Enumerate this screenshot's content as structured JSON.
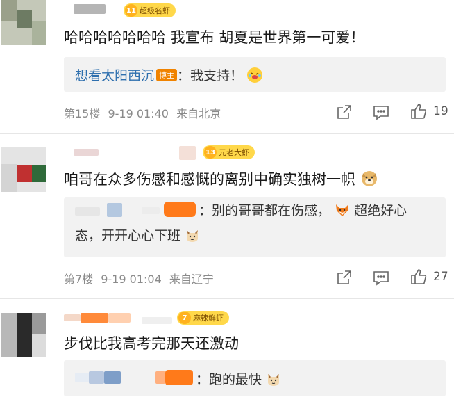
{
  "comments": [
    {
      "badge_level": "11",
      "badge_text": "超级名虾",
      "text": "哈哈哈哈哈哈哈 我宣布 胡夏是世界第一可爱！",
      "reply": {
        "author": "想看太阳西沉",
        "tag": "博主",
        "content": "：我支持！",
        "emoji": "laughing-crying-emoji"
      },
      "floor": "第15楼",
      "time": "9-19 01:40",
      "location": "来自北京",
      "likes": "19"
    },
    {
      "badge_level": "13",
      "badge_text": "元老大虾",
      "text": "咱哥在众多伤感和感慨的离别中确实独树一帜",
      "text_emoji": "doge-emoji",
      "reply": {
        "content_1": "：别的哥哥都在伤感，",
        "emoji_1": "fox-emoji",
        "content_2": "超绝好心",
        "content_3": "态，开开心心下班",
        "emoji_2": "cat-emoji"
      },
      "floor": "第7楼",
      "time": "9-19 01:04",
      "location": "来自辽宁",
      "likes": "27"
    },
    {
      "badge_level": "7",
      "badge_text": "麻辣鲜虾",
      "text": "步伐比我高考完那天还激动",
      "reply": {
        "content": "：跑的最快",
        "emoji": "cat-emoji"
      }
    }
  ],
  "colors": {
    "badge_bg": "#ffd84a",
    "reply_author": "#2e6fae",
    "meta_text": "#8a8a8a",
    "blogger_tag": "#f08300"
  }
}
